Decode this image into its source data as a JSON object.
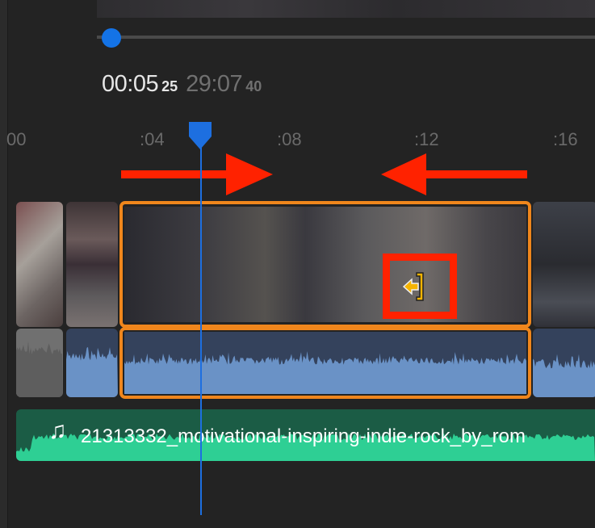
{
  "player": {
    "current_time": "00:05",
    "current_frames": "25",
    "duration": "29:07",
    "duration_frames": "40",
    "scrub_progress": 0.0
  },
  "ruler": {
    "labels": [
      "00",
      ":04",
      ":08",
      ":12",
      ":16"
    ]
  },
  "music_track": {
    "title": "21313332_motivational-inspiring-indie-rock_by_rom",
    "icon": "music-note-icon"
  },
  "annotations": {
    "arrow_color": "#ff2200",
    "selection_color": "#f0861c",
    "playhead_color": "#1d6fe0",
    "cursor": "trim-left-cursor-icon"
  }
}
